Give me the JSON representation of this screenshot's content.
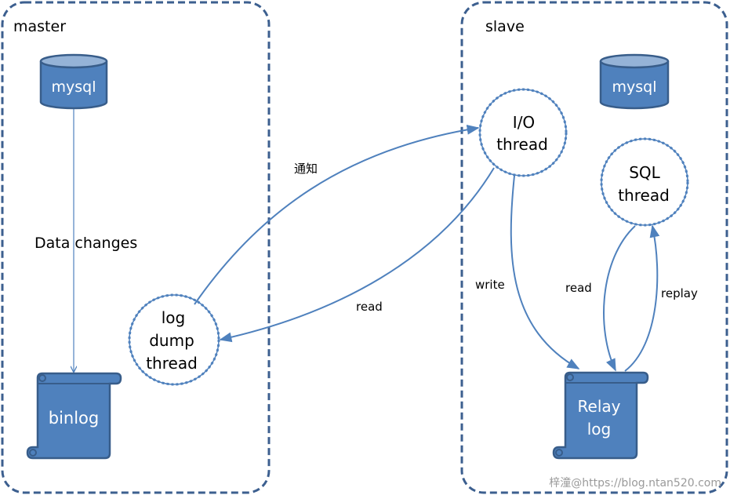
{
  "colors": {
    "frame": "#3c5f8f",
    "shape_fill": "#4f81bd",
    "shape_stroke": "#385d8a",
    "shape_top": "#95b3d7",
    "arrow": "#4f81bd",
    "thread_border": "#4f81bd"
  },
  "master": {
    "title": "master",
    "db_label": "mysql",
    "edge_label": "Data changes",
    "binlog_label": "binlog",
    "thread_lines": [
      "log",
      "dump",
      "thread"
    ]
  },
  "slave": {
    "title": "slave",
    "db_label": "mysql",
    "io_thread_lines": [
      "I/O",
      "thread"
    ],
    "sql_thread_lines": [
      "SQL",
      "thread"
    ],
    "relay_lines": [
      "Relay",
      "log"
    ]
  },
  "edges": {
    "notify": "通知",
    "read_cross": "read",
    "write": "write",
    "read_local": "read",
    "replay": "replay"
  },
  "watermark": "梓潼@https://blog.ntan520.com"
}
